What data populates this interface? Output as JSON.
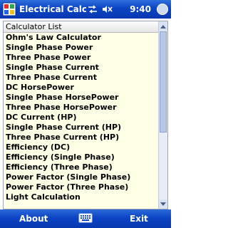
{
  "titlebar": {
    "title": "Electrical Calculators",
    "time": "9:40"
  },
  "list": {
    "header": "Calculator List",
    "items": [
      "Ohm's Law Calculator",
      "Single Phase Power",
      "Three Phase Power",
      "Single Phase Current",
      "Three Phase Current",
      "DC HorsePower",
      "Single Phase HorsePower",
      "Three Phase HorsePower",
      "DC Current (HP)",
      "Single Phase Current (HP)",
      "Three Phase Current (HP)",
      "Efficiency (DC)",
      "Efficiency (Single Phase)",
      "Efficiency (Three Phase)",
      "Power Factor (Single Phase)",
      "Power Factor (Three Phase)",
      "Light Calculation"
    ]
  },
  "menubar": {
    "left_label": "About",
    "right_label": "Exit"
  },
  "icons": {
    "app": "app-logo-icon",
    "volume": "speaker-muted-icon",
    "data": "sync-arrows-icon",
    "keyboard": "keyboard-icon"
  },
  "colors": {
    "title_bar": "#0b44c4",
    "list_background": "#ffffe6",
    "text": "#000000"
  }
}
